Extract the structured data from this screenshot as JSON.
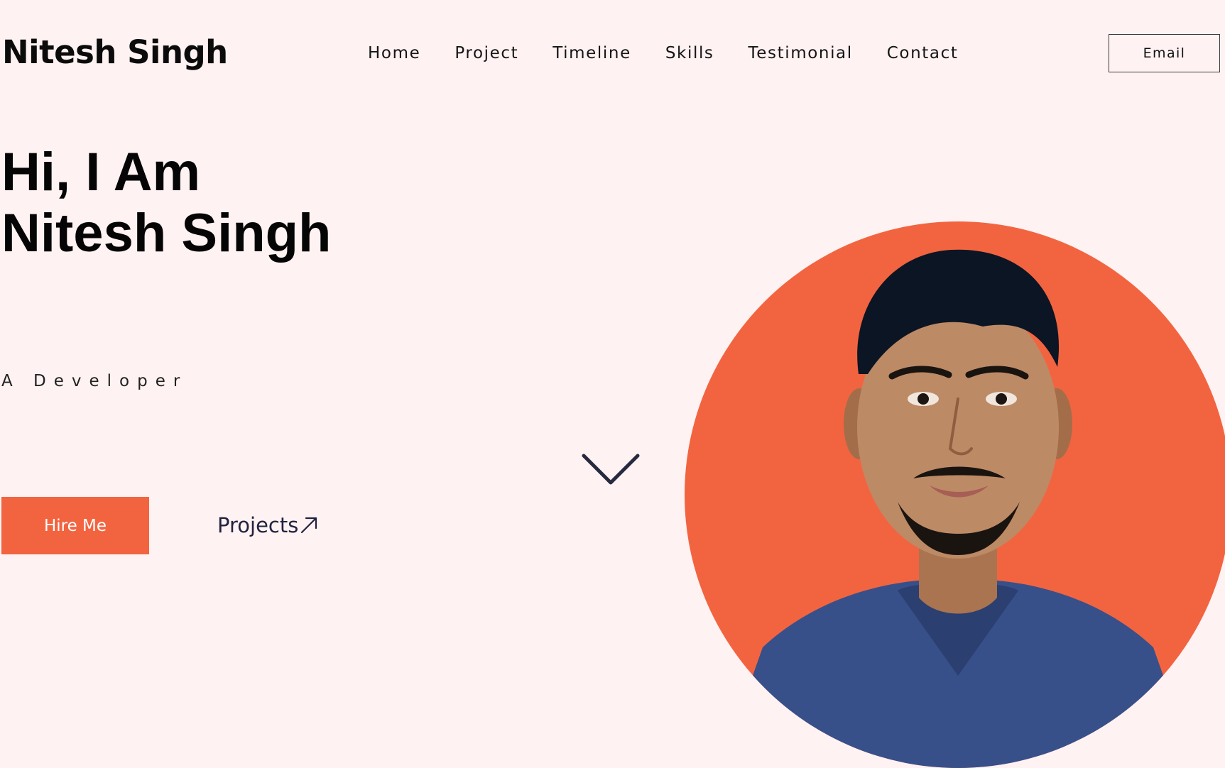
{
  "header": {
    "logo": "Nitesh Singh",
    "nav": [
      "Home",
      "Project",
      "Timeline",
      "Skills",
      "Testimonial",
      "Contact"
    ],
    "email_button": "Email"
  },
  "hero": {
    "greeting": "Hi, I Am",
    "name": "Nitesh Singh",
    "subtitle": "A Developer",
    "hire_button": "Hire Me",
    "projects_link": "Projects"
  },
  "icons": {
    "scroll": "chevron-down-icon",
    "projects": "arrow-up-right-icon"
  },
  "colors": {
    "background": "#fff2f2",
    "accent": "#f26440",
    "dark": "#1f2340"
  }
}
